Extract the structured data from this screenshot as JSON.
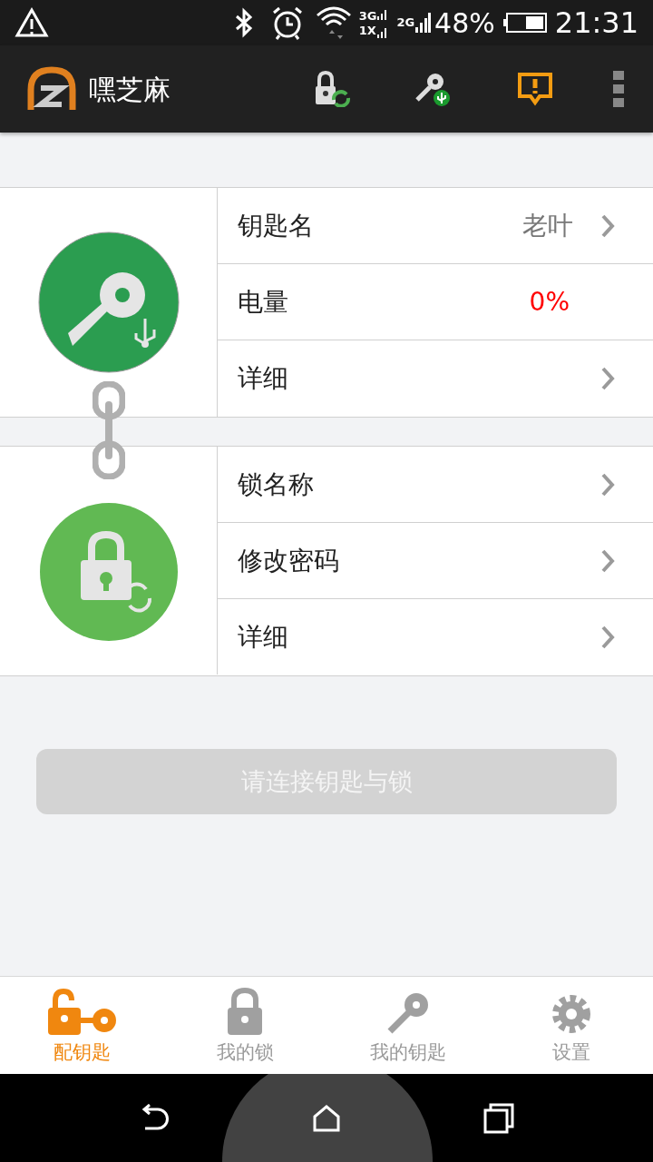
{
  "status_bar": {
    "network_top": "3G",
    "network_bottom": "1X",
    "network_second": "2G",
    "battery": "48%",
    "time": "21:31"
  },
  "app_bar": {
    "title": "嘿芝麻"
  },
  "key_section": {
    "rows": [
      {
        "kind": "link",
        "label": "钥匙名",
        "value": "老叶"
      },
      {
        "kind": "reading",
        "label": "电量",
        "value": "0%"
      },
      {
        "kind": "link",
        "label": "详细"
      }
    ]
  },
  "lock_section": {
    "rows": [
      {
        "kind": "link",
        "label": "锁名称"
      },
      {
        "kind": "link",
        "label": "修改密码"
      },
      {
        "kind": "link",
        "label": "详细"
      }
    ]
  },
  "connect_button": {
    "label": "请连接钥匙与锁",
    "disabled": true
  },
  "bottom_nav": [
    {
      "kind": "pair",
      "label": "配钥匙",
      "selected": true
    },
    {
      "kind": "lock",
      "label": "我的锁",
      "selected": false
    },
    {
      "kind": "key",
      "label": "我的钥匙",
      "selected": false
    },
    {
      "kind": "settings",
      "label": "设置",
      "selected": false
    }
  ]
}
